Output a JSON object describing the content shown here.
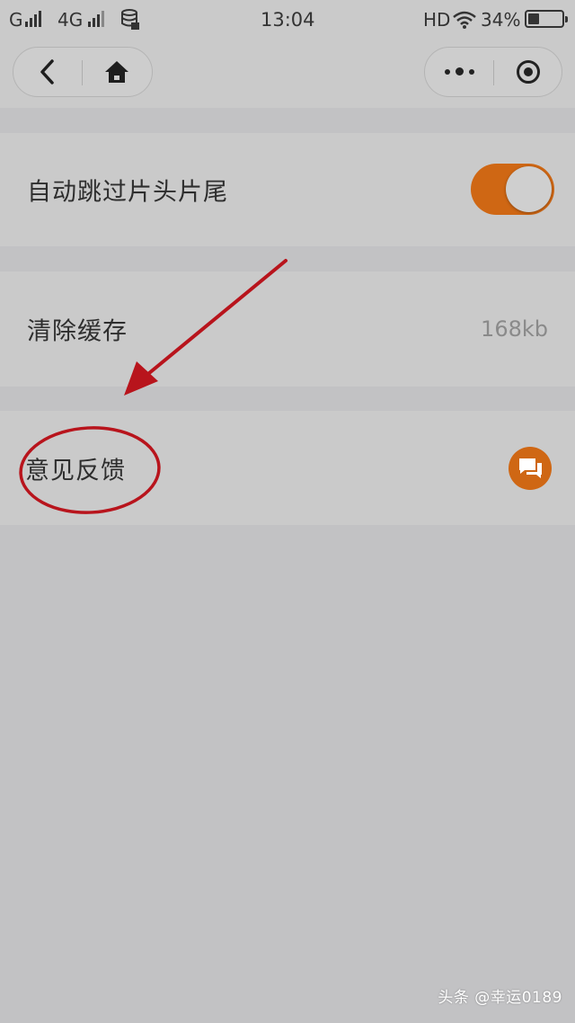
{
  "status_bar": {
    "network_1": "G",
    "network_2": "4G",
    "time": "13:04",
    "hd": "HD",
    "battery": "34%"
  },
  "nav_bar": {
    "back_icon": "chevron-left-icon",
    "home_icon": "home-icon",
    "more_icon": "more-dots-icon",
    "close_icon": "target-close-icon"
  },
  "settings": {
    "skip_intro": {
      "label": "自动跳过片头片尾",
      "enabled": true
    },
    "clear_cache": {
      "label": "清除缓存",
      "value": "168kb"
    },
    "feedback": {
      "label": "意见反馈",
      "icon": "chat-bubbles-icon"
    }
  },
  "colors": {
    "accent": "#cf6714",
    "annotation_red": "#b8141c",
    "background": "#c2c2c4",
    "row_background": "#cacaca"
  },
  "watermark": "头条 @幸运0189"
}
